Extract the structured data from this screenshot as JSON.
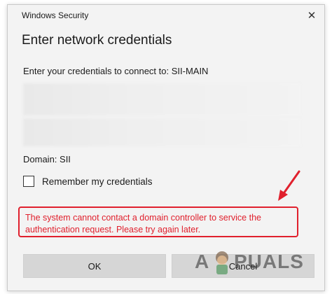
{
  "window": {
    "title": "Windows Security",
    "close_glyph": "✕"
  },
  "dialog": {
    "heading": "Enter network credentials",
    "prompt": "Enter your credentials to connect to: SII-MAIN",
    "domain": "Domain: SII",
    "remember_label": "Remember my credentials",
    "remember_checked": false,
    "error_message": "The system cannot contact a domain controller to service the authentication request. Please try again later."
  },
  "buttons": {
    "ok": "OK",
    "cancel": "Cancel"
  },
  "watermark": {
    "left": "A",
    "right": "PUALS"
  },
  "colors": {
    "error": "#e0202d",
    "dialog_bg": "#f3f3f3",
    "button_bg": "#d6d6d6"
  }
}
